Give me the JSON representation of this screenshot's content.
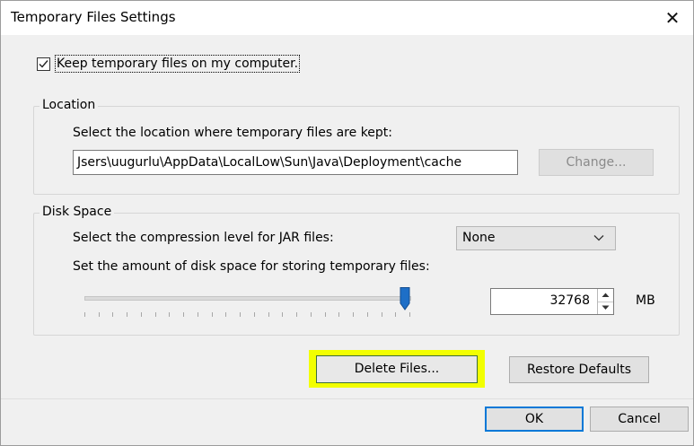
{
  "window": {
    "title": "Temporary Files Settings",
    "close_glyph": "✕"
  },
  "keep_files": {
    "label": "Keep temporary files on my computer.",
    "checked": true
  },
  "location": {
    "group_title": "Location",
    "description": "Select the location where temporary files are kept:",
    "path": "Jsers\\uugurlu\\AppData\\LocalLow\\Sun\\Java\\Deployment\\cache",
    "change_label": "Change...",
    "change_enabled": false
  },
  "disk_space": {
    "group_title": "Disk Space",
    "compression_label": "Select the compression level for JAR files:",
    "compression_value": "None",
    "amount_label": "Set the amount of disk space for storing temporary files:",
    "slider_fraction": 0.985,
    "size_value": "32768",
    "unit": "MB"
  },
  "buttons": {
    "delete": "Delete Files...",
    "restore": "Restore Defaults",
    "ok": "OK",
    "cancel": "Cancel"
  },
  "colors": {
    "highlight": "#f2ff00",
    "accent": "#0078d7",
    "slider_thumb": "#1e6fc7"
  }
}
